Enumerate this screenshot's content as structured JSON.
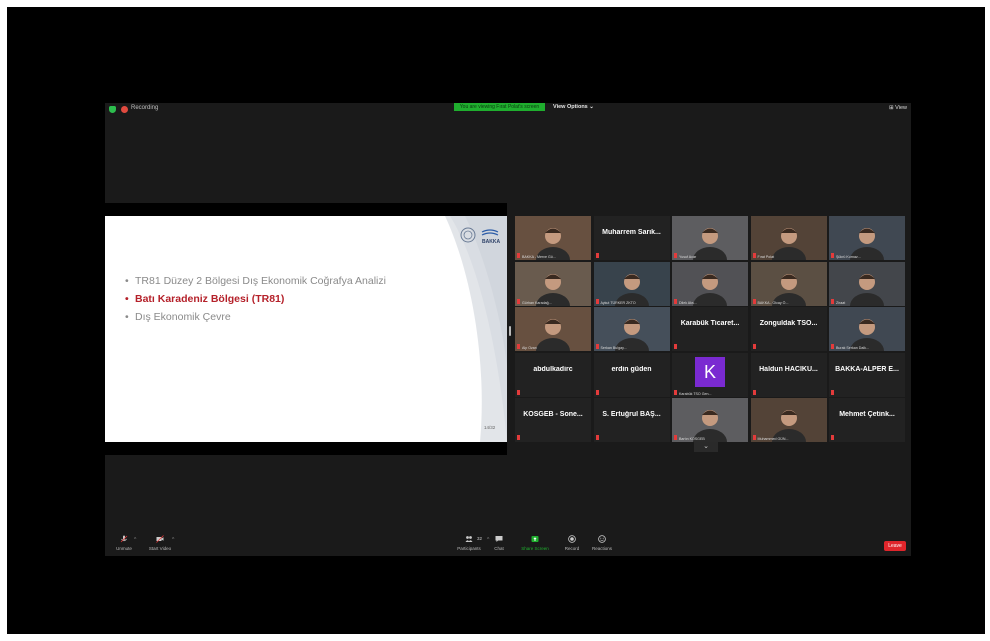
{
  "meeting": {
    "recording_label": "Recording",
    "viewing_banner": "You are viewing Fırat Polat's screen",
    "view_options": "View Options ⌄",
    "view_button": "⊞ View"
  },
  "slide": {
    "bullets": [
      "TR81 Düzey 2 Bölgesi Dış Ekonomik Coğrafya Analizi",
      "Batı Karadeniz Bölgesi (TR81)",
      "Dış Ekonomik Çevre"
    ],
    "logo_text": "BAKKA",
    "page_number": "14/32",
    "colors": {
      "highlight": "#b5212a",
      "muted": "#8a8a8a"
    }
  },
  "gallery": {
    "tiles": [
      {
        "name": "",
        "label": "BAKKA - Merve Gü..."
      },
      {
        "name": "Muharrem Sarık...",
        "label": ""
      },
      {
        "name": "",
        "label": "Yusuf Acar"
      },
      {
        "name": "",
        "label": "Fırat Polat",
        "active": true
      },
      {
        "name": "",
        "label": "Şükrü Kurnaz..."
      },
      {
        "name": "",
        "label": "Gürhan Karadağ..."
      },
      {
        "name": "",
        "label": "Aykut TÜRKER ZKTO"
      },
      {
        "name": "",
        "label": "Dilek Aks..."
      },
      {
        "name": "",
        "label": "BAKKA - Olcay Ö..."
      },
      {
        "name": "",
        "label": "Ziraat"
      },
      {
        "name": "",
        "label": "Alp Ozan"
      },
      {
        "name": "",
        "label": "Serkan Bulgay..."
      },
      {
        "name": "Karabük Ticaret...",
        "label": ""
      },
      {
        "name": "Zonguldak TSO...",
        "label": ""
      },
      {
        "name": "",
        "label": "Burak Serkan Dalk..."
      },
      {
        "name": "abdulkadirc",
        "label": ""
      },
      {
        "name": "erdin güden",
        "label": ""
      },
      {
        "name": "",
        "label": "Karabük TSO Gen...",
        "avatar": "K"
      },
      {
        "name": "Haldun HACIKU...",
        "label": ""
      },
      {
        "name": "BAKKA-ALPER E...",
        "label": ""
      },
      {
        "name": "KOSGEB - Sone...",
        "label": ""
      },
      {
        "name": "S. Ertuğrul BAŞ...",
        "label": ""
      },
      {
        "name": "",
        "label": "Bartın KOSGEB"
      },
      {
        "name": "",
        "label": "Muhammed GÜN..."
      },
      {
        "name": "Mehmet Çetink...",
        "label": ""
      }
    ],
    "scroll_icon": "⌄"
  },
  "toolbar": {
    "unmute": "Unmute",
    "start_video": "Start Video",
    "participants": "Participants",
    "participants_count": "32",
    "chat": "Chat",
    "share_screen": "Share Screen",
    "record": "Record",
    "reactions": "Reactions",
    "leave": "Leave",
    "caret": "^",
    "share_color": "#1fae2e"
  }
}
